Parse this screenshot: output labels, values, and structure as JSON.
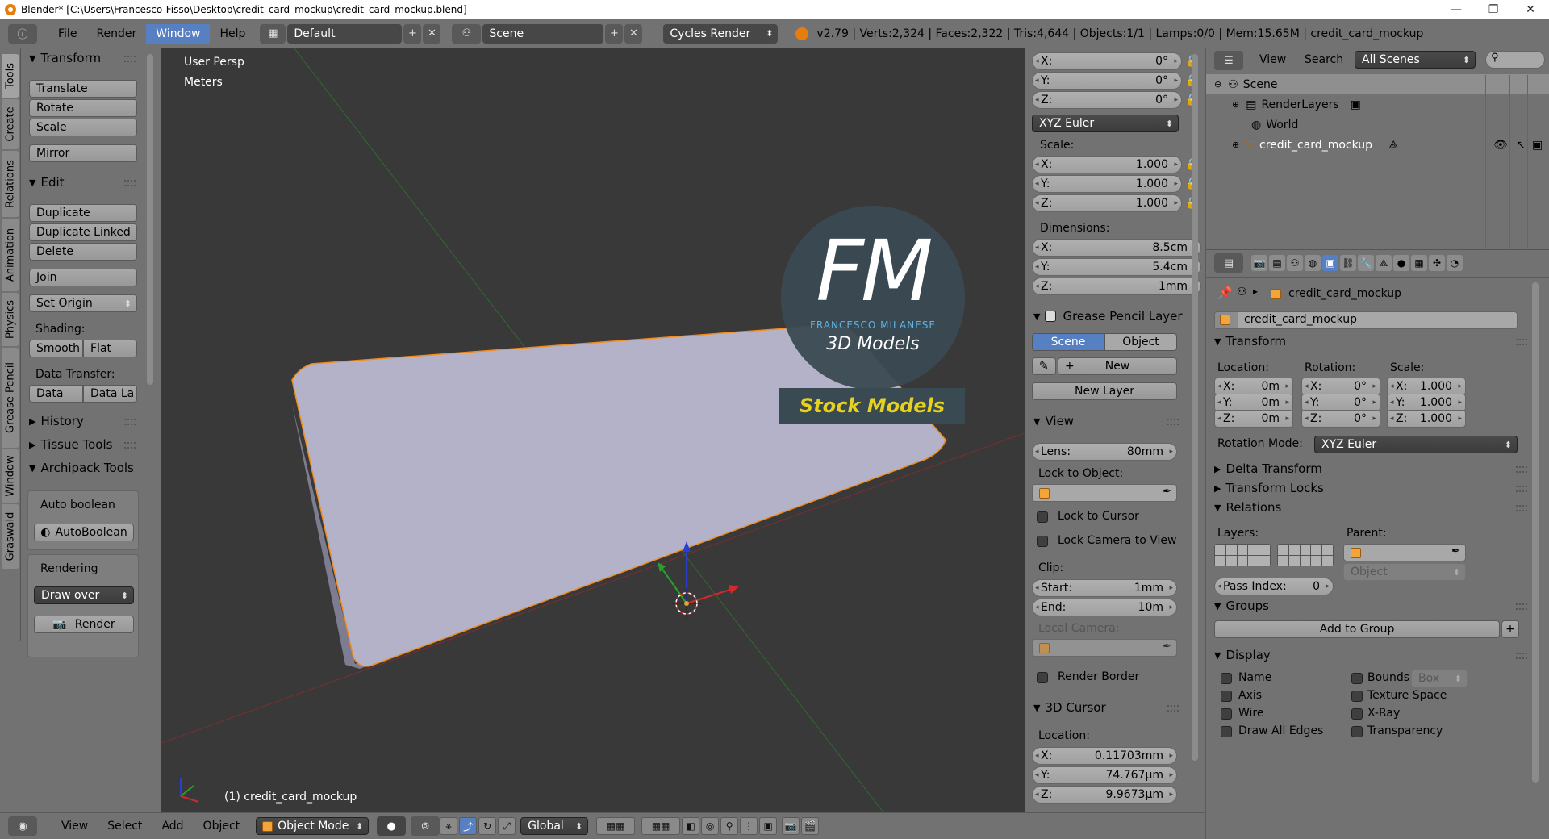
{
  "titlebar": {
    "title": "Blender* [C:\\Users\\Francesco-Fisso\\Desktop\\credit_card_mockup\\credit_card_mockup.blend]",
    "minimize": "—",
    "maximize": "❐",
    "close": "✕"
  },
  "header": {
    "info_icon": "ⓘ",
    "menus": [
      "File",
      "Render",
      "Window",
      "Help"
    ],
    "active_menu": "Window",
    "screen_layout": "Default",
    "scene": "Scene",
    "render_engine": "Cycles Render",
    "stats": "v2.79 | Verts:2,324 | Faces:2,322 | Tris:4,644 | Objects:1/1 | Lamps:0/0 | Mem:15.65M | credit_card_mockup"
  },
  "tool_tabs": [
    "Tools",
    "Create",
    "Relations",
    "Animation",
    "Physics",
    "Grease Pencil",
    "Window",
    "Graswald"
  ],
  "tool_shelf": {
    "transform": {
      "title": "Transform",
      "buttons": [
        "Translate",
        "Rotate",
        "Scale",
        "Mirror"
      ]
    },
    "edit": {
      "title": "Edit",
      "buttons": [
        "Duplicate",
        "Duplicate Linked",
        "Delete",
        "Join"
      ],
      "set_origin": "Set Origin",
      "shading_label": "Shading:",
      "smooth": "Smooth",
      "flat": "Flat",
      "data_transfer_label": "Data Transfer:",
      "data": "Data",
      "data_layers": "Data La"
    },
    "history": "History",
    "tissue": "Tissue Tools",
    "archipack": "Archipack Tools",
    "auto_boolean_label": "Auto boolean",
    "auto_boolean_button": "AutoBoolean",
    "rendering_label": "Rendering",
    "draw_over": "Draw over",
    "render_button": "Render"
  },
  "viewport": {
    "view_name": "User Persp",
    "units": "Meters",
    "object_label": "(1) credit_card_mockup",
    "watermark": {
      "letters": "FM",
      "author": "FRANCESCO MILANESE",
      "subtitle": "3D Models",
      "banner": "Stock Models"
    }
  },
  "npanel": {
    "rotation": [
      {
        "axis": "X:",
        "value": "0°"
      },
      {
        "axis": "Y:",
        "value": "0°"
      },
      {
        "axis": "Z:",
        "value": "0°"
      }
    ],
    "rotation_mode": "XYZ Euler",
    "scale_label": "Scale:",
    "scale": [
      {
        "axis": "X:",
        "value": "1.000"
      },
      {
        "axis": "Y:",
        "value": "1.000"
      },
      {
        "axis": "Z:",
        "value": "1.000"
      }
    ],
    "dimensions_label": "Dimensions:",
    "dimensions": [
      {
        "axis": "X:",
        "value": "8.5cm"
      },
      {
        "axis": "Y:",
        "value": "5.4cm"
      },
      {
        "axis": "Z:",
        "value": "1mm"
      }
    ],
    "grease_pencil": {
      "title": "Grease Pencil Layer",
      "scene_tab": "Scene",
      "object_tab": "Object",
      "new": "New",
      "new_layer": "New Layer"
    },
    "view": {
      "title": "View",
      "lens_key": "Lens:",
      "lens_value": "80mm",
      "lock_to_object": "Lock to Object:",
      "lock_to_cursor": "Lock to Cursor",
      "lock_camera": "Lock Camera to View",
      "clip_label": "Clip:",
      "start_key": "Start:",
      "start_value": "1mm",
      "end_key": "End:",
      "end_value": "10m",
      "local_camera": "Local Camera:",
      "render_border": "Render Border"
    },
    "cursor": {
      "title": "3D Cursor",
      "location_label": "Location:",
      "location": [
        {
          "axis": "X:",
          "value": "0.11703mm"
        },
        {
          "axis": "Y:",
          "value": "74.767µm"
        },
        {
          "axis": "Z:",
          "value": "9.9673µm"
        }
      ]
    }
  },
  "outliner": {
    "menus": [
      "View",
      "Search"
    ],
    "filter": "All Scenes",
    "rows": [
      "Scene",
      "RenderLayers",
      "World",
      "credit_card_mockup"
    ]
  },
  "properties": {
    "breadcrumb": "credit_card_mockup",
    "object_name": "credit_card_mockup",
    "transform": {
      "title": "Transform",
      "location_label": "Location:",
      "rotation_label": "Rotation:",
      "scale_label": "Scale:",
      "location": [
        {
          "axis": "X:",
          "value": "0m"
        },
        {
          "axis": "Y:",
          "value": "0m"
        },
        {
          "axis": "Z:",
          "value": "0m"
        }
      ],
      "rotation": [
        {
          "axis": "X:",
          "value": "0°"
        },
        {
          "axis": "Y:",
          "value": "0°"
        },
        {
          "axis": "Z:",
          "value": "0°"
        }
      ],
      "scale": [
        {
          "axis": "X:",
          "value": "1.000"
        },
        {
          "axis": "Y:",
          "value": "1.000"
        },
        {
          "axis": "Z:",
          "value": "1.000"
        }
      ],
      "rotation_mode_label": "Rotation Mode:",
      "rotation_mode": "XYZ Euler"
    },
    "delta_transform": "Delta Transform",
    "transform_locks": "Transform Locks",
    "relations": {
      "title": "Relations",
      "layers_label": "Layers:",
      "parent_label": "Parent:",
      "parent_type": "Object",
      "pass_index_key": "Pass Index:",
      "pass_index_value": "0"
    },
    "groups": {
      "title": "Groups",
      "add": "Add to Group"
    },
    "display": {
      "title": "Display",
      "name": "Name",
      "axis": "Axis",
      "wire": "Wire",
      "draw_all_edges": "Draw All Edges",
      "bounds": "Bounds",
      "bounds_type": "Box",
      "texture_space": "Texture Space",
      "xray": "X-Ray",
      "transparency": "Transparency"
    }
  },
  "bottom": {
    "menus": [
      "View",
      "Select",
      "Add",
      "Object"
    ],
    "mode": "Object Mode",
    "orientation": "Global"
  },
  "colors": {
    "accent": "#5680c2",
    "viewport_bg": "#393939",
    "panel_bg": "#727272",
    "card": "#b4b2c8",
    "selection_outline": "#f08c1e",
    "watermark_text": "#5ab4e6",
    "banner_text": "#e6d21e"
  }
}
